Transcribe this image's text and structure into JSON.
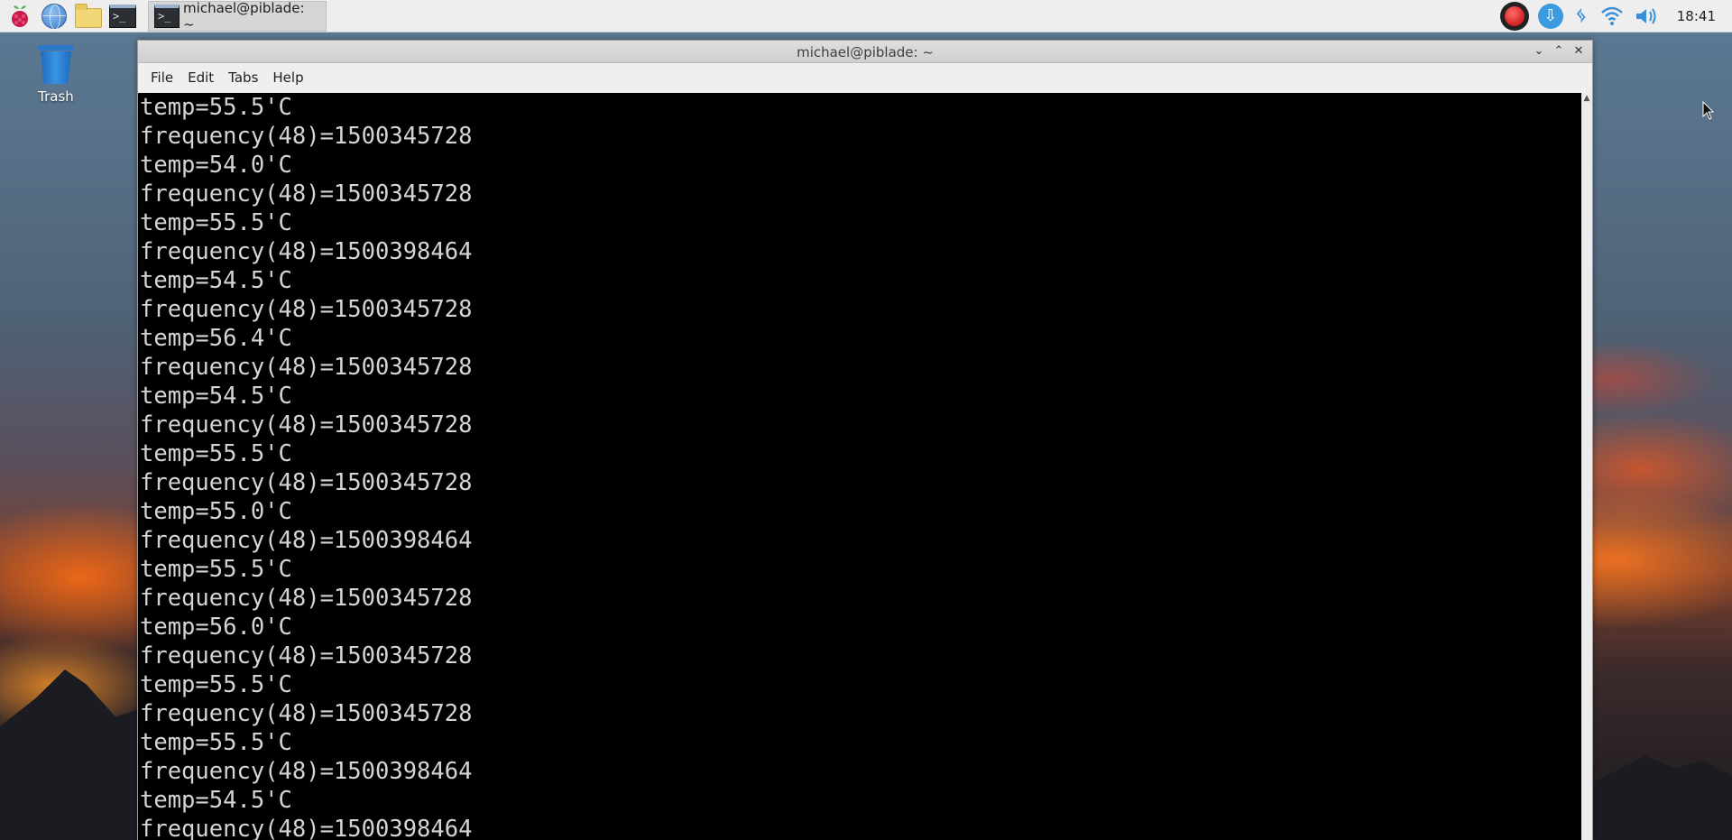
{
  "taskbar": {
    "launchers": [
      "raspberry-menu",
      "web-browser",
      "file-manager",
      "terminal"
    ],
    "task_label": "michael@piblade: ~",
    "clock": "18:41"
  },
  "desktop": {
    "trash_label": "Trash"
  },
  "window": {
    "title": "michael@piblade: ~",
    "controls": [
      "v",
      "^",
      "x"
    ],
    "menu": [
      "File",
      "Edit",
      "Tabs",
      "Help"
    ]
  },
  "terminal": {
    "lines": [
      "temp=55.5'C",
      "frequency(48)=1500345728",
      "temp=54.0'C",
      "frequency(48)=1500345728",
      "temp=55.5'C",
      "frequency(48)=1500398464",
      "temp=54.5'C",
      "frequency(48)=1500345728",
      "temp=56.4'C",
      "frequency(48)=1500345728",
      "temp=54.5'C",
      "frequency(48)=1500345728",
      "temp=55.5'C",
      "frequency(48)=1500345728",
      "temp=55.0'C",
      "frequency(48)=1500398464",
      "temp=55.5'C",
      "frequency(48)=1500345728",
      "temp=56.0'C",
      "frequency(48)=1500345728",
      "temp=55.5'C",
      "frequency(48)=1500345728",
      "temp=55.5'C",
      "frequency(48)=1500398464",
      "temp=54.5'C",
      "frequency(48)=1500398464"
    ]
  }
}
